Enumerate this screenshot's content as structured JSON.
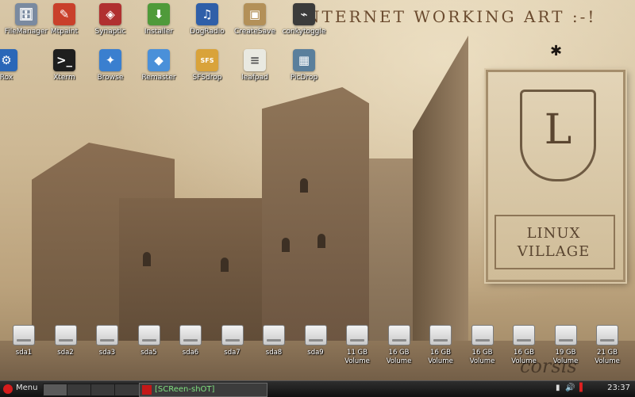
{
  "wallpaper": {
    "banner": "NTERNET WORKING ART :-!",
    "plaque_letter": "L",
    "plaque_line1": "LINUX",
    "plaque_line2": "VILLAGE",
    "signature": "corsis"
  },
  "desktop_icons": [
    {
      "label": "FileManager",
      "icon": "file-manager-icon",
      "color": "#7a8aa0",
      "glyph": "🗄"
    },
    {
      "label": "Mtpaint",
      "icon": "pencils-icon",
      "color": "#c9402b",
      "glyph": "✎"
    },
    {
      "label": "Synaptic",
      "icon": "package-icon",
      "color": "#b03030",
      "glyph": "◈"
    },
    {
      "label": "Installer",
      "icon": "installer-icon",
      "color": "#4f9a3a",
      "glyph": "⬇"
    },
    {
      "label": "DogRadio",
      "icon": "radio-headphones-icon",
      "color": "#2f5fa8",
      "glyph": "♫"
    },
    {
      "label": "CreateSave",
      "icon": "save-box-icon",
      "color": "#b39058",
      "glyph": "▣"
    },
    {
      "label": "conkytoggle",
      "icon": "monitor-graph-icon",
      "color": "#3b3b3b",
      "glyph": "⌁"
    },
    {
      "label": "Rox",
      "icon": "rox-gear-icon",
      "color": "#2a67b8",
      "glyph": "⚙"
    },
    {
      "label": "Xterm",
      "icon": "terminal-icon",
      "color": "#1e1e1e",
      "glyph": ">_"
    },
    {
      "label": "Browse",
      "icon": "compass-icon",
      "color": "#3a7fcf",
      "glyph": "✦"
    },
    {
      "label": "Remaster",
      "icon": "disc-icon",
      "color": "#4a90d9",
      "glyph": "◆"
    },
    {
      "label": "SFSdrop",
      "icon": "sfs-package-icon",
      "color": "#d9a33a",
      "glyph": "SFS"
    },
    {
      "label": "leafpad",
      "icon": "notepad-icon",
      "color": "#e9e9e1",
      "glyph": "≡"
    },
    {
      "label": "PicDrop",
      "icon": "picture-icon",
      "color": "#5a7f9c",
      "glyph": "▦"
    }
  ],
  "drives": [
    {
      "label": "sda1"
    },
    {
      "label": "sda2"
    },
    {
      "label": "sda3"
    },
    {
      "label": "sda5"
    },
    {
      "label": "sda6"
    },
    {
      "label": "sda7"
    },
    {
      "label": "sda8"
    },
    {
      "label": "sda9"
    },
    {
      "label": "11 GB\nVolume"
    },
    {
      "label": "16 GB\nVolume"
    },
    {
      "label": "16 GB\nVolume"
    },
    {
      "label": "16 GB\nVolume"
    },
    {
      "label": "16 GB\nVolume"
    },
    {
      "label": "19 GB\nVolume"
    },
    {
      "label": "21 GB\nVolume"
    }
  ],
  "taskbar": {
    "menu_label": "Menu",
    "task_title": "[SCReen-shOT]",
    "clock": "23:37"
  }
}
